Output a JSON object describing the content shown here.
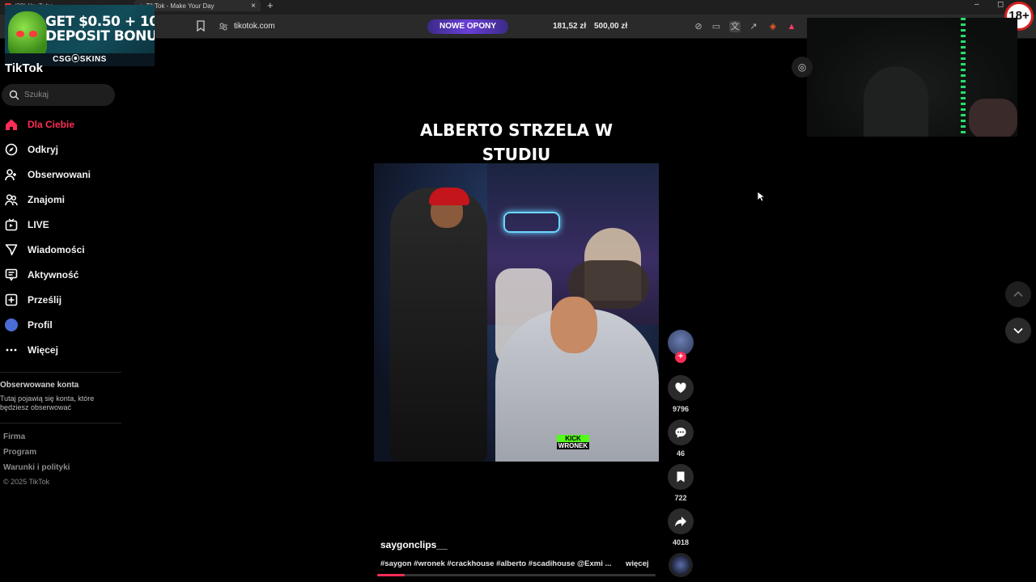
{
  "browser": {
    "tabs": [
      {
        "title": "(29) YouTube"
      },
      {
        "title": "TikTok - Make Your Day"
      }
    ],
    "url": "tikotok.com",
    "promo_label": "NOWE OPONY",
    "balances": [
      "181,52 zł",
      "500,00 zł"
    ],
    "window_controls": [
      "–",
      "◻",
      "✕"
    ]
  },
  "ad": {
    "headline_a": "GET $0.50 + 10",
    "headline_b": "DEPOSIT BONU",
    "brand": "CSG⦿SKINS"
  },
  "age_badge": "18+",
  "sidebar": {
    "brand_partial": "TikTok",
    "search_placeholder": "Szukaj",
    "items": [
      {
        "label": "Dla Ciebie",
        "icon": "home-icon",
        "active": true
      },
      {
        "label": "Odkryj",
        "icon": "compass-icon"
      },
      {
        "label": "Obserwowani",
        "icon": "user-plus-icon"
      },
      {
        "label": "Znajomi",
        "icon": "friends-icon"
      },
      {
        "label": "LIVE",
        "icon": "live-icon"
      },
      {
        "label": "Wiadomości",
        "icon": "send-icon"
      },
      {
        "label": "Aktywność",
        "icon": "activity-icon"
      },
      {
        "label": "Prześlij",
        "icon": "upload-icon"
      },
      {
        "label": "Profil",
        "icon": "avatar-icon"
      },
      {
        "label": "Więcej",
        "icon": "more-icon"
      }
    ],
    "followed_heading": "Obserwowane konta",
    "followed_text": "Tutaj pojawią się konta, które będziesz obserwować",
    "footer_links": [
      "Firma",
      "Program",
      "Warunki i polityki"
    ],
    "copyright": "© 2025 TikTok"
  },
  "video": {
    "title_line1": "ALBERTO STRZELA W",
    "title_line2": "STUDIU",
    "overlay_tag_top": "KICK",
    "overlay_tag_bottom": "WRONEK",
    "author": "saygonclips__",
    "caption": "#saygon #wronek #crackhouse #alberto #scadihouse @Exmi ...",
    "more_label": "więcej",
    "progress": 0.1
  },
  "actions": {
    "likes": "9796",
    "comments": "46",
    "saves": "722",
    "shares": "4018"
  },
  "colors": {
    "accent": "#fe2c55",
    "promo": "#6a3fd6"
  }
}
